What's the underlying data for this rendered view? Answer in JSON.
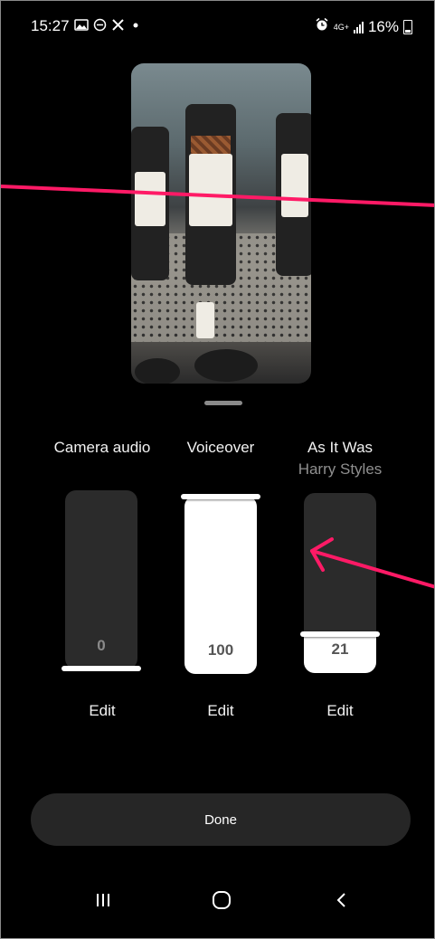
{
  "status_bar": {
    "time": "15:27",
    "battery": "16%",
    "network": "4G+",
    "left_icons": [
      "gallery-icon",
      "dnd-icon",
      "x-icon",
      "dot-icon"
    ],
    "right_icons": [
      "alarm-icon",
      "network-icon",
      "signal-icon",
      "battery-icon"
    ]
  },
  "mixer": {
    "tracks": [
      {
        "title": "Camera audio",
        "subtitle": "",
        "level": 0,
        "level_label": "0",
        "edit_label": "Edit"
      },
      {
        "title": "Voiceover",
        "subtitle": "",
        "level": 100,
        "level_label": "100",
        "edit_label": "Edit"
      },
      {
        "title": "As It Was",
        "subtitle": "Harry Styles",
        "level": 21,
        "level_label": "21",
        "edit_label": "Edit"
      }
    ]
  },
  "done_label": "Done",
  "annotations": {
    "color": "#ff1a66"
  },
  "nav": {
    "items": [
      "recents-icon",
      "home-icon",
      "back-icon"
    ]
  }
}
